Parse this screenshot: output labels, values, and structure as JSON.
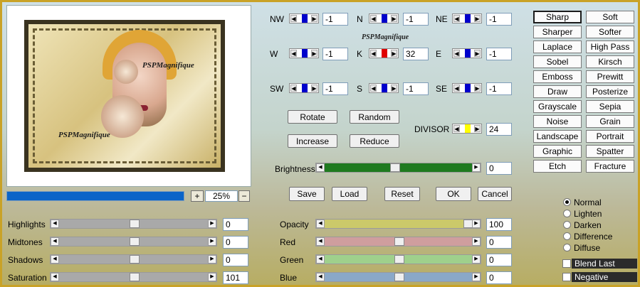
{
  "colors": {
    "border": "#c9a227",
    "progress": "#0a64c8",
    "brightness": "#1f7a1f",
    "opacity": "#cbc96a",
    "red": "#cf9e9e",
    "green": "#9fd08c",
    "blue": "#8aa8c8",
    "gray": "#a9a9a9",
    "kernel_active": "#e00000",
    "kernel": "#0000cc",
    "divisor": "#ffff00"
  },
  "preview": {
    "watermark_main": "PSPMagnifique",
    "watermark_bottom": "PSPMagnifique",
    "watermark_mid": "PSPMagnifique"
  },
  "progress": {
    "value_fraction": 1.0
  },
  "zoom": {
    "plus": "+",
    "value": "25%",
    "minus": "−"
  },
  "kernel": [
    {
      "label": "NW",
      "value": "-1"
    },
    {
      "label": "N",
      "value": "-1"
    },
    {
      "label": "NE",
      "value": "-1"
    },
    {
      "label": "W",
      "value": "-1"
    },
    {
      "label": "K",
      "value": "32"
    },
    {
      "label": "E",
      "value": "-1"
    },
    {
      "label": "SW",
      "value": "-1"
    },
    {
      "label": "S",
      "value": "-1"
    },
    {
      "label": "SE",
      "value": "-1"
    }
  ],
  "actions": {
    "rotate": "Rotate",
    "random": "Random",
    "increase": "Increase",
    "reduce": "Reduce"
  },
  "divisor": {
    "label": "DIVISOR",
    "value": "24"
  },
  "brightness": {
    "label": "Brightness",
    "value": "0"
  },
  "dialog": {
    "save": "Save",
    "load": "Load",
    "reset": "Reset",
    "ok": "OK",
    "cancel": "Cancel"
  },
  "filters": [
    [
      "Sharp",
      "Soft"
    ],
    [
      "Sharper",
      "Softer"
    ],
    [
      "Laplace",
      "High Pass"
    ],
    [
      "Sobel",
      "Kirsch"
    ],
    [
      "Emboss",
      "Prewitt"
    ],
    [
      "Draw",
      "Posterize"
    ],
    [
      "Grayscale",
      "Sepia"
    ],
    [
      "Noise",
      "Grain"
    ],
    [
      "Landscape",
      "Portrait"
    ],
    [
      "Graphic",
      "Spatter"
    ],
    [
      "Etch",
      "Fracture"
    ]
  ],
  "selected_filter": "Sharp",
  "tones": [
    {
      "label": "Highlights",
      "value": "0",
      "level": 0.5
    },
    {
      "label": "Midtones",
      "value": "0",
      "level": 0.5
    },
    {
      "label": "Shadows",
      "value": "0",
      "level": 0.5
    },
    {
      "label": "Saturation",
      "value": "101",
      "level": 0.5
    }
  ],
  "channels": [
    {
      "label": "Opacity",
      "value": "100",
      "level": 1.0
    },
    {
      "label": "Red",
      "value": "0",
      "level": 0.5
    },
    {
      "label": "Green",
      "value": "0",
      "level": 0.5
    },
    {
      "label": "Blue",
      "value": "0",
      "level": 0.5
    }
  ],
  "blend_modes": [
    "Normal",
    "Lighten",
    "Darken",
    "Difference",
    "Diffuse"
  ],
  "blend_selected": "Normal",
  "options": {
    "blend_last": "Blend Last",
    "negative": "Negative"
  }
}
